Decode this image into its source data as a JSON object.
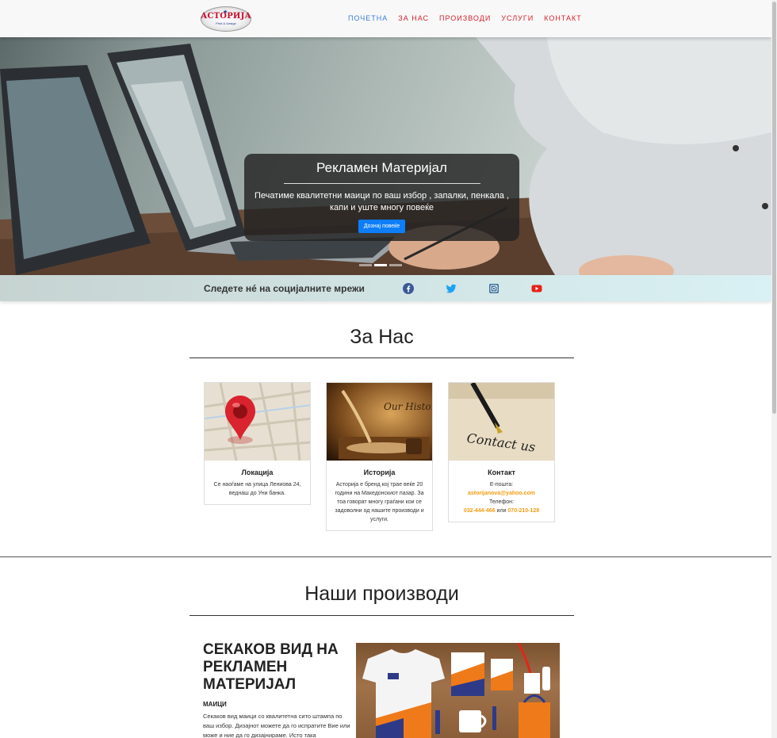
{
  "navbar": {
    "logo": {
      "main": "АСТОРИЈА",
      "sub": "Print & Design"
    },
    "links": [
      {
        "label": "ПОЧЕТНА",
        "active": true
      },
      {
        "label": "ЗА НАС",
        "active": false
      },
      {
        "label": "ПРОИЗВОДИ",
        "active": false
      },
      {
        "label": "УСЛУГИ",
        "active": false
      },
      {
        "label": "КОНТАКТ",
        "active": false
      }
    ]
  },
  "hero": {
    "title": "Рекламен Материјал",
    "text": "Печатиме квалитетни маици по ваш избор , запалки, пенкала , капи и уште многу повеќе",
    "button_label": "Дознај повеќе",
    "slides_count": 3,
    "active_slide": 2
  },
  "social": {
    "text": "Следете нé на социјалните мрежи",
    "icons": [
      "facebook-icon",
      "twitter-icon",
      "instagram-icon",
      "youtube-icon"
    ],
    "colors": {
      "facebook": "#3b5998",
      "twitter": "#1da1f2",
      "instagram": "#3f729b",
      "youtube": "#e62117"
    }
  },
  "about": {
    "title": "За Нас",
    "cards": [
      {
        "title": "Локација",
        "text": "Се наоѓаме на улица Лениова 24, веднаш до Уни банка."
      },
      {
        "title": "Историја",
        "text": "Асторија е бренд кој трае веќе 20 години на Македонскиот пазар. За тоа говорат многу граѓани кои се задоволни од нашите производи и услуги."
      },
      {
        "title": "Контакт",
        "email_label": "Е-пошта:",
        "email": "astorijanova@yahoo.com",
        "phone_label": "Телефон:",
        "phone1": "032-444-466",
        "or": "или",
        "phone2": "070-210-128"
      }
    ],
    "card_image_text": {
      "history": "Our History",
      "contact": "Contact us"
    }
  },
  "products": {
    "title": "Наши производи",
    "heading": "СЕКАКОВ ВИД НА РЕКЛАМЕН МАТЕРИЈАЛ",
    "subheading": "МАИЦИ",
    "text": "Секаков вид маици со квалитетна сито штампа по ваш избор. Дизајнот можете да го испратите Вие или може и ние да го дизајнираме. Исто така"
  },
  "colors": {
    "nav_red": "#d7232f",
    "nav_active": "#3b7ddd",
    "accent_orange": "#f39c12",
    "button_blue": "#0d7ef8"
  }
}
